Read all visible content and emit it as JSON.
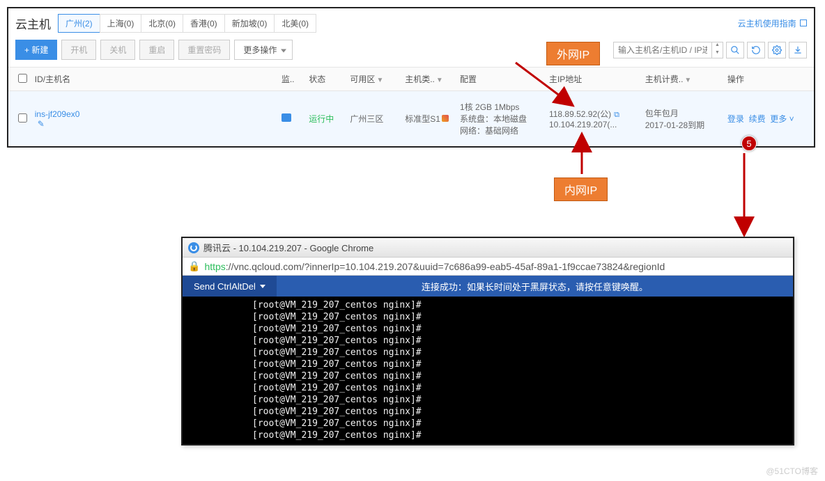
{
  "top": {
    "title": "云主机",
    "regions": [
      {
        "label": "广州(2)",
        "active": true
      },
      {
        "label": "上海(0)",
        "active": false
      },
      {
        "label": "北京(0)",
        "active": false
      },
      {
        "label": "香港(0)",
        "active": false
      },
      {
        "label": "新加坡(0)",
        "active": false
      },
      {
        "label": "北美(0)",
        "active": false
      }
    ],
    "guide_link": "云主机使用指南",
    "toolbar": {
      "create": "+ 新建",
      "start": "开机",
      "stop": "关机",
      "reboot": "重启",
      "resetpw": "重置密码",
      "more": "更多操作",
      "search_placeholder": "输入主机名/主机ID / IP进"
    },
    "columns": {
      "idname": "ID/主机名",
      "monitor": "监..",
      "status": "状态",
      "zone": "可用区",
      "type": "主机类..",
      "config": "配置",
      "ip": "主IP地址",
      "billing": "主机计费..",
      "ops": "操作"
    },
    "row": {
      "id": "ins-jf209ex0",
      "status": "运行中",
      "zone": "广州三区",
      "type": "标准型S1",
      "config_l1": "1核 2GB 1Mbps",
      "config_l2": "系统盘：本地磁盘",
      "config_l3": "网络：基础网络",
      "ip_pub": "118.89.52.92(公)",
      "ip_prv": "10.104.219.207(...",
      "bill_l1": "包年包月",
      "bill_l2": "2017-01-28到期",
      "op_login": "登录",
      "op_renew": "续费",
      "op_more": "更多"
    }
  },
  "annotations": {
    "wan": "外网IP",
    "lan": "内网IP",
    "step": "5"
  },
  "bottom": {
    "window_title": "腾讯云 - 10.104.219.207 - Google Chrome",
    "url_scheme": "https",
    "url_rest": "://vnc.qcloud.com/?innerIp=10.104.219.207&uuid=7c686a99-eab5-45af-89a1-1f9ccae73824&regionId",
    "send_btn": "Send CtrlAltDel",
    "vnc_msg": "连接成功：如果长时间处于黑屏状态，请按任意键唤醒。",
    "term_line": "[root@VM_219_207_centos nginx]#",
    "term_count": 12
  },
  "watermark": "@51CTO博客"
}
